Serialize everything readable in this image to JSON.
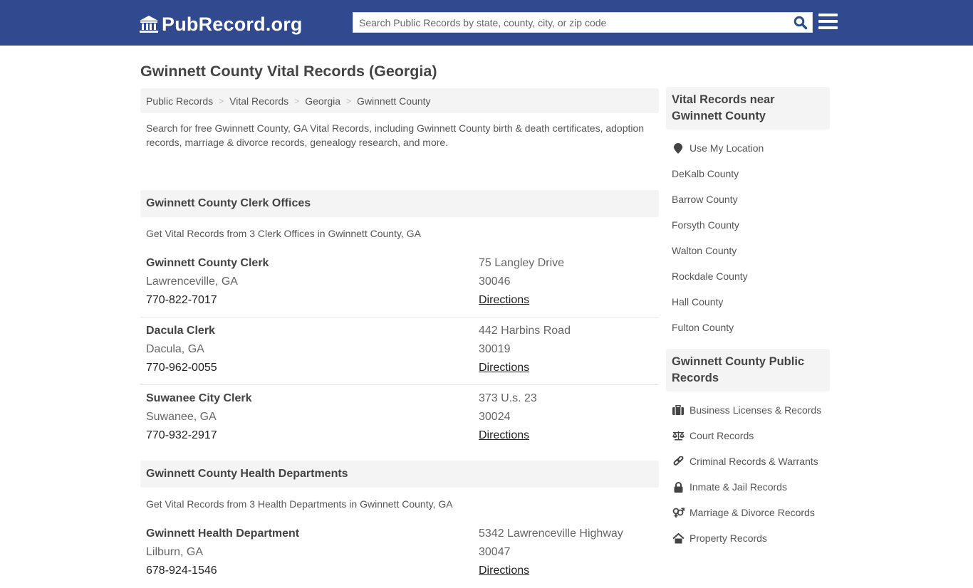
{
  "header": {
    "logo_text": "PubRecord.org",
    "search_placeholder": "Search Public Records by state, county, city, or zip code",
    "colors": {
      "bar": "#30498f",
      "search_icon": "#2a4d8c"
    }
  },
  "page": {
    "title": "Gwinnett County Vital Records (Georgia)"
  },
  "breadcrumb": [
    {
      "label": "Public Records"
    },
    {
      "label": "Vital Records"
    },
    {
      "label": "Georgia"
    },
    {
      "label": "Gwinnett County"
    }
  ],
  "intro": "Search for free Gwinnett County, GA Vital Records, including Gwinnett County birth & death certificates, adoption records, marriage & divorce records, genealogy research, and more.",
  "sections": [
    {
      "title": "Gwinnett County Clerk Offices",
      "subtitle": "Get Vital Records from 3 Clerk Offices in Gwinnett County, GA",
      "entries": [
        {
          "name": "Gwinnett County Clerk",
          "city": "Lawrenceville, GA",
          "phone": "770-822-7017",
          "address": "75 Langley Drive",
          "zip": "30046",
          "directions": "Directions"
        },
        {
          "name": "Dacula Clerk",
          "city": "Dacula, GA",
          "phone": "770-962-0055",
          "address": "442 Harbins Road",
          "zip": "30019",
          "directions": "Directions"
        },
        {
          "name": "Suwanee City Clerk",
          "city": "Suwanee, GA",
          "phone": "770-932-2917",
          "address": "373 U.s. 23",
          "zip": "30024",
          "directions": "Directions"
        }
      ]
    },
    {
      "title": "Gwinnett County Health Departments",
      "subtitle": "Get Vital Records from 3 Health Departments in Gwinnett County, GA",
      "entries": [
        {
          "name": "Gwinnett Health Department",
          "city": "Lilburn, GA",
          "phone": "678-924-1546",
          "address": "5342 Lawrenceville Highway",
          "zip": "30047",
          "directions": "Directions"
        }
      ]
    }
  ],
  "sidebar": {
    "nearby": {
      "title": "Vital Records near Gwinnett County",
      "use_location": "Use My Location",
      "counties": [
        "DeKalb County",
        "Barrow County",
        "Forsyth County",
        "Walton County",
        "Rockdale County",
        "Hall County",
        "Fulton County"
      ]
    },
    "public_records": {
      "title": "Gwinnett County Public Records",
      "items": [
        {
          "label": "Business Licenses & Records",
          "icon": "briefcase-icon"
        },
        {
          "label": "Court Records",
          "icon": "scales-icon"
        },
        {
          "label": "Criminal Records & Warrants",
          "icon": "link-icon"
        },
        {
          "label": "Inmate & Jail Records",
          "icon": "lock-icon"
        },
        {
          "label": "Marriage & Divorce Records",
          "icon": "gender-icon"
        },
        {
          "label": "Property Records",
          "icon": "home-icon"
        }
      ]
    }
  }
}
